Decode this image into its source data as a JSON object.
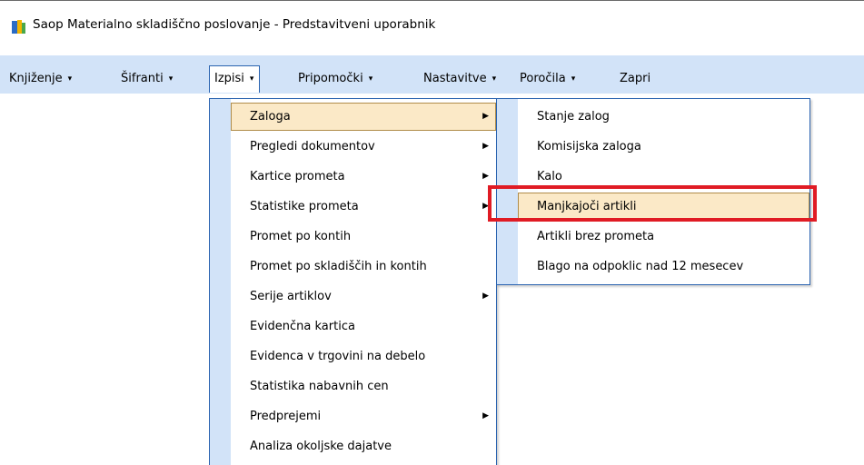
{
  "window": {
    "title": "Saop  Materialno skladiščno poslovanje - Predstavitveni uporabnik",
    "icon": "app-icon",
    "accent": "#2a63b0",
    "menubar_bg": "#d2e3f8",
    "highlight_bg": "#fbe9c7",
    "callout_color": "#e01b24"
  },
  "menubar": {
    "items": [
      {
        "label": "Knjiženje",
        "arrow": "▾"
      },
      {
        "label": "Šifranti",
        "arrow": "▾"
      },
      {
        "label": "Izpisi",
        "arrow": "▾"
      },
      {
        "label": "Pripomočki",
        "arrow": "▾"
      },
      {
        "label": "Nastavitve",
        "arrow": "▾"
      },
      {
        "label": "Poročila",
        "arrow": "▾"
      },
      {
        "label": "Zapri",
        "arrow": ""
      }
    ]
  },
  "izpisi_menu": {
    "items": [
      {
        "label": "Zaloga",
        "submenu": "▶"
      },
      {
        "label": "Pregledi dokumentov",
        "submenu": "▶"
      },
      {
        "label": "Kartice prometa",
        "submenu": "▶"
      },
      {
        "label": "Statistike prometa",
        "submenu": "▶"
      },
      {
        "label": "Promet po kontih",
        "submenu": ""
      },
      {
        "label": "Promet po skladiščih in kontih",
        "submenu": ""
      },
      {
        "label": "Serije artiklov",
        "submenu": "▶"
      },
      {
        "label": "Evidenčna kartica",
        "submenu": ""
      },
      {
        "label": "Evidenca v trgovini na debelo",
        "submenu": ""
      },
      {
        "label": "Statistika nabavnih cen",
        "submenu": ""
      },
      {
        "label": "Predprejemi",
        "submenu": "▶"
      },
      {
        "label": "Analiza okoljske dajatve",
        "submenu": ""
      }
    ]
  },
  "zaloga_submenu": {
    "items": [
      {
        "label": "Stanje zalog"
      },
      {
        "label": "Komisijska zaloga"
      },
      {
        "label": "Kalo"
      },
      {
        "label": "Manjkajoči artikli"
      },
      {
        "label": "Artikli brez prometa"
      },
      {
        "label": "Blago na odpoklic nad 12 mesecev"
      }
    ]
  }
}
